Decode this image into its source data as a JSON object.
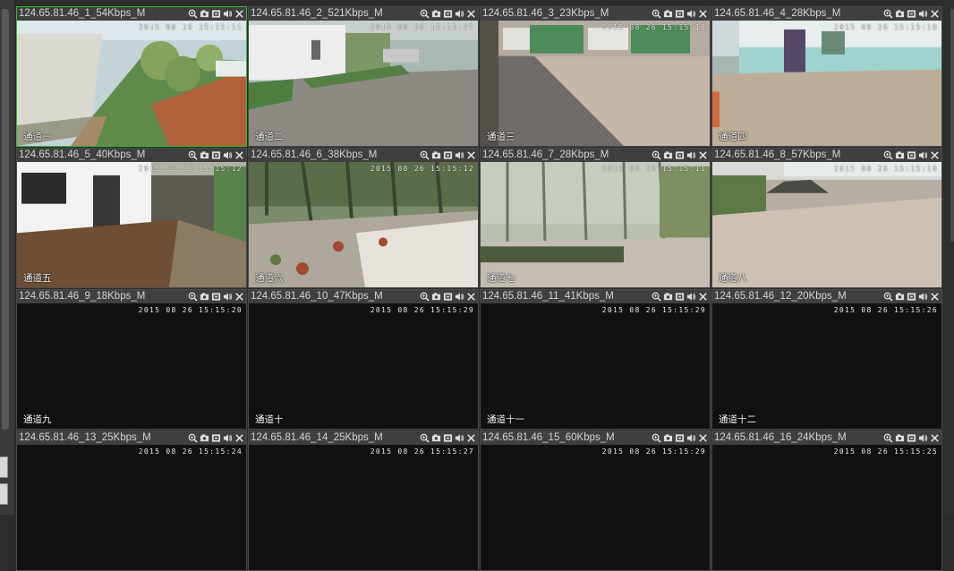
{
  "colors": {
    "active_border": "#27c227",
    "titlebar_bg": "#3f3f3f",
    "titlebar_text": "#d4d4d4",
    "tile_bg": "#111111"
  },
  "icons": [
    "zoom-icon",
    "snapshot-icon",
    "record-icon",
    "audio-icon",
    "close-icon"
  ],
  "channels": [
    {
      "title": "124.65.81.46_1_54Kbps_M",
      "timestamp": "2015 08 26 15:15:11",
      "label": "通道一",
      "active": true
    },
    {
      "title": "124.65.81.46_2_521Kbps_M",
      "timestamp": "2015 08 26 15:15:27",
      "label": "通道二"
    },
    {
      "title": "124.65.81.46_3_23Kbps_M",
      "timestamp": "2015 08 26 15:15:18",
      "label": "通道三"
    },
    {
      "title": "124.65.81.46_4_28Kbps_M",
      "timestamp": "2015 08 26 15:15:10",
      "label": "通道四"
    },
    {
      "title": "124.65.81.46_5_40Kbps_M",
      "timestamp": "2015 08 26 15:15:12",
      "label": "通道五"
    },
    {
      "title": "124.65.81.46_6_38Kbps_M",
      "timestamp": "2015 08 26 15:15:12",
      "label": "通道六"
    },
    {
      "title": "124.65.81.46_7_28Kbps_M",
      "timestamp": "2015 08 26 15:15:11",
      "label": "通道七"
    },
    {
      "title": "124.65.81.46_8_57Kbps_M",
      "timestamp": "2015 08 26 15:15:10",
      "label": "通道八"
    },
    {
      "title": "124.65.81.46_9_18Kbps_M",
      "timestamp": "2015 08 26 15:15:20",
      "label": "通道九"
    },
    {
      "title": "124.65.81.46_10_47Kbps_M",
      "timestamp": "2015 08 26 15:15:29",
      "label": "通道十"
    },
    {
      "title": "124.65.81.46_11_41Kbps_M",
      "timestamp": "2015 08 26 15:15:29",
      "label": "通道十一"
    },
    {
      "title": "124.65.81.46_12_20Kbps_M",
      "timestamp": "2015 08 26 15:15:26",
      "label": "通道十二"
    },
    {
      "title": "124.65.81.46_13_25Kbps_M",
      "timestamp": "2015 08 26 15:15:24",
      "label": ""
    },
    {
      "title": "124.65.81.46_14_25Kbps_M",
      "timestamp": "2015 08 26 15:15:27",
      "label": ""
    },
    {
      "title": "124.65.81.46_15_60Kbps_M",
      "timestamp": "2015 08 26 15:15:29",
      "label": ""
    },
    {
      "title": "124.65.81.46_16_24Kbps_M",
      "timestamp": "2015 08 26 15:15:25",
      "label": ""
    }
  ]
}
